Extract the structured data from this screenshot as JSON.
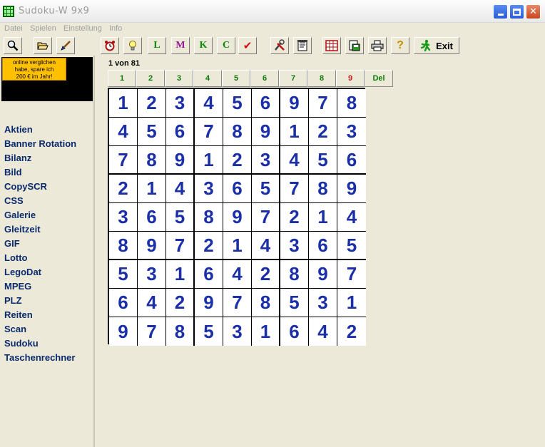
{
  "window": {
    "title": "Sudoku-W   9x9"
  },
  "menu": [
    "Datei",
    "Spielen",
    "Einstellung",
    "Info"
  ],
  "toolbar": {
    "letters": [
      {
        "text": "L",
        "color": "#0a8a0a"
      },
      {
        "text": "M",
        "color": "#9a1a9a"
      },
      {
        "text": "K",
        "color": "#0a8a0a"
      },
      {
        "text": "C",
        "color": "#0a8a0a"
      }
    ],
    "check_symbol": "✔",
    "help_symbol": "?",
    "exit_label": "Exit"
  },
  "ad": {
    "lines": [
      "online verglichen",
      "habe, spare ich",
      "200 € im Jahr!"
    ]
  },
  "sidebar": {
    "items": [
      "Aktien",
      "Banner Rotation",
      "Bilanz",
      "Bild",
      "CopySCR",
      "CSS",
      "Galerie",
      "Gleitzeit",
      "GIF",
      "Lotto",
      "LegoDat",
      "MPEG",
      "PLZ",
      "Reiten",
      "Scan",
      "Sudoku",
      "Taschenrechner"
    ]
  },
  "game": {
    "counter": "1 von 81",
    "number_buttons": [
      {
        "label": "1",
        "color": "#0a7a0a"
      },
      {
        "label": "2",
        "color": "#0a7a0a"
      },
      {
        "label": "3",
        "color": "#0a7a0a"
      },
      {
        "label": "4",
        "color": "#0a7a0a"
      },
      {
        "label": "5",
        "color": "#0a7a0a"
      },
      {
        "label": "6",
        "color": "#0a7a0a"
      },
      {
        "label": "7",
        "color": "#0a7a0a"
      },
      {
        "label": "8",
        "color": "#0a7a0a"
      },
      {
        "label": "9",
        "color": "#cc1a1a"
      }
    ],
    "delete_label": "Del",
    "grid": [
      [
        1,
        2,
        3,
        4,
        5,
        6,
        9,
        7,
        8
      ],
      [
        4,
        5,
        6,
        7,
        8,
        9,
        1,
        2,
        3
      ],
      [
        7,
        8,
        9,
        1,
        2,
        3,
        4,
        5,
        6
      ],
      [
        2,
        1,
        4,
        3,
        6,
        5,
        7,
        8,
        9
      ],
      [
        3,
        6,
        5,
        8,
        9,
        7,
        2,
        1,
        4
      ],
      [
        8,
        9,
        7,
        2,
        1,
        4,
        3,
        6,
        5
      ],
      [
        5,
        3,
        1,
        6,
        4,
        2,
        8,
        9,
        7
      ],
      [
        6,
        4,
        2,
        9,
        7,
        8,
        5,
        3,
        1
      ],
      [
        9,
        7,
        8,
        5,
        3,
        1,
        6,
        4,
        2
      ]
    ]
  }
}
